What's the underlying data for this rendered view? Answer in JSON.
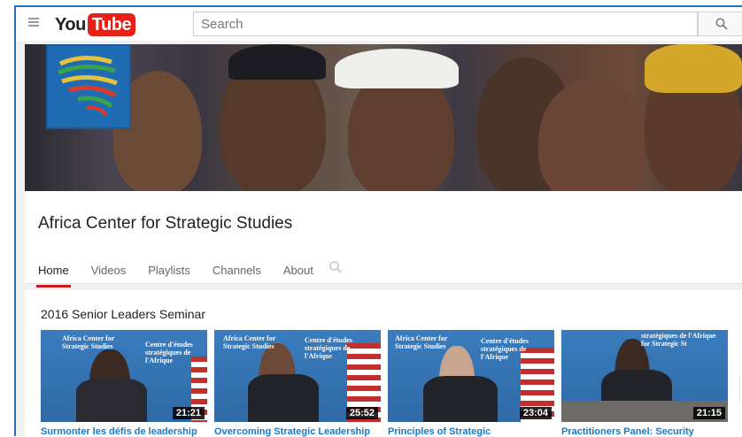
{
  "header": {
    "logo_you": "You",
    "logo_tube": "Tube",
    "search_placeholder": "Search"
  },
  "channel": {
    "title": "Africa Center for Strategic Studies",
    "tabs": [
      {
        "label": "Home",
        "active": true
      },
      {
        "label": "Videos",
        "active": false
      },
      {
        "label": "Playlists",
        "active": false
      },
      {
        "label": "Channels",
        "active": false
      },
      {
        "label": "About",
        "active": false
      }
    ]
  },
  "section": {
    "title": "2016 Senior Leaders Seminar",
    "videos": [
      {
        "title": "Surmonter les défis de leadership",
        "duration": "21:21",
        "thumb_left": "Africa Center for Strategic Studies",
        "thumb_right": "Centre d'études stratégiques de l'Afrique"
      },
      {
        "title": "Overcoming Strategic Leadership",
        "duration": "25:52",
        "thumb_left": "Africa Center for Strategic Studies",
        "thumb_right": "Centre d'études stratégiques de l'Afrique"
      },
      {
        "title": "Principles of Strategic",
        "duration": "23:04",
        "thumb_left": "Africa Center for Strategic Studies",
        "thumb_right": "Centre d'études stratégiques de l'Afrique"
      },
      {
        "title": "Practitioners Panel: Security",
        "duration": "21:15",
        "thumb_left": "",
        "thumb_right": "stratégiques de l'Afrique for Strategic St"
      }
    ]
  },
  "colors": {
    "brand_red": "#e62117",
    "active_tab": "#cc181e",
    "link_blue": "#167ac6"
  },
  "icons": {
    "menu": "menu-icon",
    "search": "search-icon",
    "tab_search": "search-icon",
    "next": "chevron-right-icon"
  }
}
